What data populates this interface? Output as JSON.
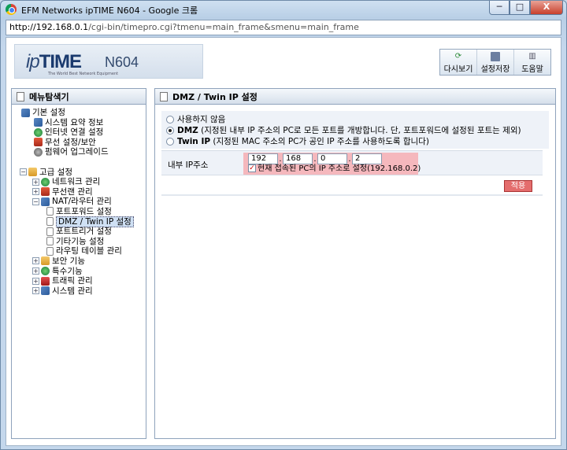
{
  "window": {
    "title": "EFM Networks ipTIME N604 - Google 크롬",
    "controls": {
      "minimize": "─",
      "maximize": "□",
      "close": "X"
    }
  },
  "address": {
    "host": "http://192.168.0.1",
    "path": "/cgi-bin/timepro.cgi?tmenu=main_frame&smenu=main_frame"
  },
  "header": {
    "logo_ip": "ip",
    "logo_time": "TIME",
    "logo_model": "N604",
    "logo_tagline": "The World Best Network Equipment",
    "buttons": [
      {
        "label": "다시보기",
        "icon": "refresh-icon"
      },
      {
        "label": "설정저장",
        "icon": "save-icon"
      },
      {
        "label": "도움말",
        "icon": "help-icon"
      }
    ]
  },
  "menu": {
    "title": "메뉴탐색기",
    "basic": {
      "label": "기본 설정",
      "items": [
        "시스템 요약 정보",
        "인터넷 연결 설정",
        "무선 설정/보안",
        "펌웨어 업그레이드"
      ]
    },
    "advanced": {
      "label": "고급 설정",
      "items": [
        {
          "label": "네트워크 관리",
          "expand": "+"
        },
        {
          "label": "무선랜 관리",
          "expand": "+"
        },
        {
          "label": "NAT/라우터 관리",
          "expand": "−"
        }
      ],
      "nat_children": [
        "포트포워드 설정",
        "DMZ / Twin IP 설정",
        "포트트리거 설정",
        "기타기능 설정",
        "라우팅 테이블 관리"
      ],
      "others": [
        "보안 기능",
        "특수기능",
        "트래픽 관리",
        "시스템 관리"
      ]
    }
  },
  "main": {
    "title": "DMZ / Twin IP 설정",
    "options": [
      {
        "label": "사용하지 않음",
        "bold": "",
        "desc": "",
        "selected": false
      },
      {
        "label": "",
        "bold": "DMZ",
        "desc": " (지정된 내부 IP 주소의 PC로 모든 포트를 개방합니다. 단, 포트포워드에 설정된 포트는 제외)",
        "selected": true
      },
      {
        "label": "",
        "bold": "Twin IP",
        "desc": " (지정된 MAC 주소의 PC가 공인 IP 주소를 사용하도록 합니다)",
        "selected": false
      }
    ],
    "internal_ip_label": "내부 IP주소",
    "ip_octets": [
      "192",
      "168",
      "0",
      "2"
    ],
    "use_current_pc_label": "현재 접속된 PC의 IP 주소로 설정(192.168.0.2)",
    "use_current_pc_checked": true,
    "apply_label": "적용"
  }
}
